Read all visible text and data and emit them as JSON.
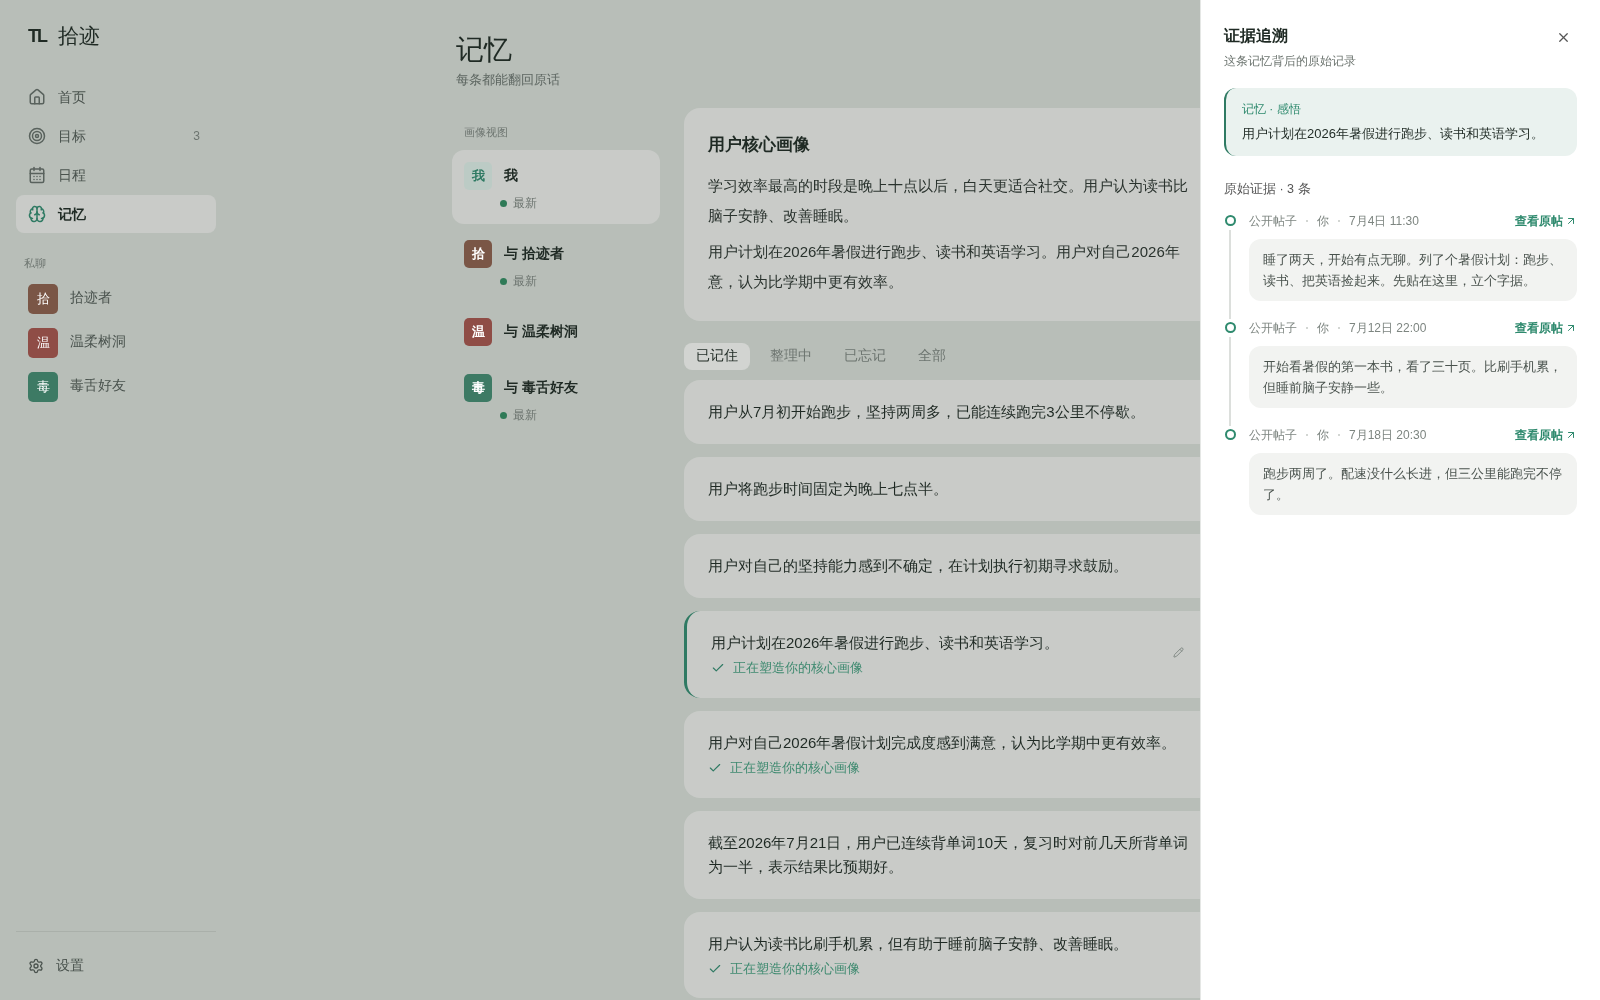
{
  "sidebar": {
    "logo_mark": "TL",
    "app_name": "拾迹",
    "nav": [
      {
        "label": "首页",
        "selected": false
      },
      {
        "label": "目标",
        "badge": "3",
        "selected": false
      },
      {
        "label": "日程",
        "selected": false
      },
      {
        "label": "记忆",
        "selected": true
      }
    ],
    "private_heading": "私聊",
    "chats": [
      {
        "avatar": "拾",
        "name": "拾迹者",
        "color": "#7a5646"
      },
      {
        "avatar": "温",
        "name": "温柔树洞",
        "color": "#8f4d46"
      },
      {
        "avatar": "毒",
        "name": "毒舌好友",
        "color": "#3d7a64"
      }
    ],
    "settings": "设置"
  },
  "page": {
    "title": "记忆",
    "subtitle": "每条都能翻回原话"
  },
  "profile_views": {
    "heading": "画像视图",
    "items": [
      {
        "avatar": "我",
        "name": "我",
        "status": "最新",
        "selected": true,
        "color": "#bccbc5"
      },
      {
        "avatar": "拾",
        "name": "与 拾迹者",
        "status": "最新",
        "selected": false,
        "color": "#7a5646"
      },
      {
        "avatar": "温",
        "name": "与 温柔树洞",
        "selected": false,
        "color": "#8f4d46"
      },
      {
        "avatar": "毒",
        "name": "与 毒舌好友",
        "status": "最新",
        "selected": false,
        "color": "#3d7a64"
      }
    ]
  },
  "core_profile": {
    "title": "用户核心画像",
    "paragraphs": [
      [
        "学习效率最高的时段是晚上十点以后，白天更适合社交。用户认为读书比",
        "脑子安静、改善睡眠。"
      ],
      [
        "用户计划在2026年暑假进行跑步、读书和英语学习。用户对自己2026年",
        "意，认为比学期中更有效率。"
      ]
    ]
  },
  "tabs": [
    {
      "label": "已记住",
      "selected": true
    },
    {
      "label": "整理中",
      "selected": false
    },
    {
      "label": "已忘记",
      "selected": false
    },
    {
      "label": "全部",
      "selected": false
    }
  ],
  "memories": [
    {
      "lines": [
        "用户从7月初开始跑步，坚持两周多，已能连续跑完3公里不停歇。"
      ],
      "selected": false
    },
    {
      "lines": [
        "用户将跑步时间固定为晚上七点半。"
      ],
      "selected": false
    },
    {
      "lines": [
        "用户对自己的坚持能力感到不确定，在计划执行初期寻求鼓励。"
      ],
      "selected": false
    },
    {
      "lines": [
        "用户计划在2026年暑假进行跑步、读书和英语学习。"
      ],
      "shaping": "正在塑造你的核心画像",
      "selected": true
    },
    {
      "lines": [
        "用户对自己2026年暑假计划完成度感到满意，认为比学期中更有效率。"
      ],
      "shaping": "正在塑造你的核心画像",
      "selected": false
    },
    {
      "lines": [
        "截至2026年7月21日，用户已连续背单词10天，复习时对前几天所背单词",
        "为一半，表示结果比预期好。"
      ],
      "selected": false
    },
    {
      "lines": [
        "用户认为读书比刷手机累，但有助于睡前脑子安静、改善睡眠。"
      ],
      "shaping": "正在塑造你的核心画像",
      "selected": false
    }
  ],
  "drawer": {
    "title": "证据追溯",
    "subtitle": "这条记忆背后的原始记录",
    "memory": {
      "meta": "记忆 · 感悟",
      "text": "用户计划在2026年暑假进行跑步、读书和英语学习。"
    },
    "evidence_heading": "原始证据 · 3 条",
    "evidence": [
      {
        "source": "公开帖子",
        "author": "你",
        "time": "7月4日 11:30",
        "link": "查看原帖",
        "text": "睡了两天，开始有点无聊。列了个暑假计划：跑步、读书、把英语捡起来。先贴在这里，立个字据。"
      },
      {
        "source": "公开帖子",
        "author": "你",
        "time": "7月12日 22:00",
        "link": "查看原帖",
        "text": "开始看暑假的第一本书，看了三十页。比刷手机累，但睡前脑子安静一些。"
      },
      {
        "source": "公开帖子",
        "author": "你",
        "time": "7月18日 20:30",
        "link": "查看原帖",
        "text": "跑步两周了。配速没什么长进，但三公里能跑完不停了。"
      }
    ]
  }
}
